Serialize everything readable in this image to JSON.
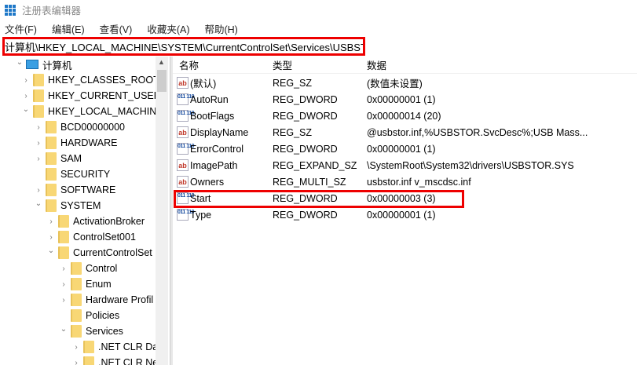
{
  "window": {
    "title": "注册表编辑器"
  },
  "menu": [
    "文件(F)",
    "编辑(E)",
    "查看(V)",
    "收藏夹(A)",
    "帮助(H)"
  ],
  "address": "计算机\\HKEY_LOCAL_MACHINE\\SYSTEM\\CurrentControlSet\\Services\\USBSTOR",
  "tree": [
    {
      "label": "计算机",
      "level": 0,
      "exp": "open",
      "icon": "pc"
    },
    {
      "label": "HKEY_CLASSES_ROOT",
      "level": 1,
      "exp": "closed"
    },
    {
      "label": "HKEY_CURRENT_USER",
      "level": 1,
      "exp": "closed"
    },
    {
      "label": "HKEY_LOCAL_MACHINE",
      "level": 1,
      "exp": "open"
    },
    {
      "label": "BCD00000000",
      "level": 2,
      "exp": "closed"
    },
    {
      "label": "HARDWARE",
      "level": 2,
      "exp": "closed"
    },
    {
      "label": "SAM",
      "level": 2,
      "exp": "closed"
    },
    {
      "label": "SECURITY",
      "level": 2,
      "exp": "none"
    },
    {
      "label": "SOFTWARE",
      "level": 2,
      "exp": "closed"
    },
    {
      "label": "SYSTEM",
      "level": 2,
      "exp": "open"
    },
    {
      "label": "ActivationBroker",
      "level": 3,
      "exp": "closed"
    },
    {
      "label": "ControlSet001",
      "level": 3,
      "exp": "closed"
    },
    {
      "label": "CurrentControlSet",
      "level": 3,
      "exp": "open"
    },
    {
      "label": "Control",
      "level": 4,
      "exp": "closed"
    },
    {
      "label": "Enum",
      "level": 4,
      "exp": "closed"
    },
    {
      "label": "Hardware Profil",
      "level": 4,
      "exp": "closed"
    },
    {
      "label": "Policies",
      "level": 4,
      "exp": "none"
    },
    {
      "label": "Services",
      "level": 4,
      "exp": "open"
    },
    {
      "label": ".NET CLR Dat",
      "level": 5,
      "exp": "closed"
    },
    {
      "label": ".NET CLR Ne",
      "level": 5,
      "exp": "closed"
    }
  ],
  "columns": [
    "名称",
    "类型",
    "数据"
  ],
  "values": [
    {
      "name": "(默认)",
      "type": "REG_SZ",
      "data": "(数值未设置)",
      "icon": "sz"
    },
    {
      "name": "AutoRun",
      "type": "REG_DWORD",
      "data": "0x00000001 (1)",
      "icon": "bin"
    },
    {
      "name": "BootFlags",
      "type": "REG_DWORD",
      "data": "0x00000014 (20)",
      "icon": "bin"
    },
    {
      "name": "DisplayName",
      "type": "REG_SZ",
      "data": "@usbstor.inf,%USBSTOR.SvcDesc%;USB Mass...",
      "icon": "sz"
    },
    {
      "name": "ErrorControl",
      "type": "REG_DWORD",
      "data": "0x00000001 (1)",
      "icon": "bin"
    },
    {
      "name": "ImagePath",
      "type": "REG_EXPAND_SZ",
      "data": "\\SystemRoot\\System32\\drivers\\USBSTOR.SYS",
      "icon": "sz"
    },
    {
      "name": "Owners",
      "type": "REG_MULTI_SZ",
      "data": "usbstor.inf v_mscdsc.inf",
      "icon": "sz"
    },
    {
      "name": "Start",
      "type": "REG_DWORD",
      "data": "0x00000003 (3)",
      "icon": "bin"
    },
    {
      "name": "Type",
      "type": "REG_DWORD",
      "data": "0x00000001 (1)",
      "icon": "bin"
    }
  ],
  "highlight_color": "#e00000"
}
